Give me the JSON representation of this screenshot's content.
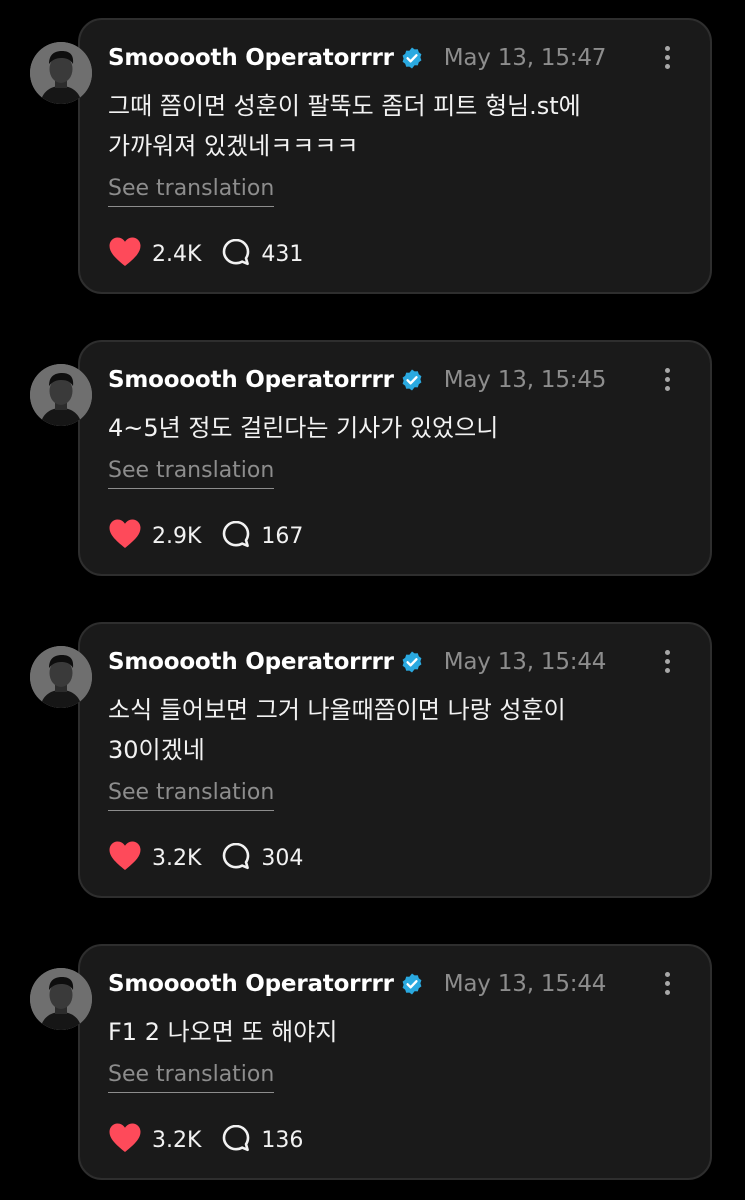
{
  "colors": {
    "background": "#000000",
    "card": "#1a1a1a",
    "card_border": "#2e2e2e",
    "verified_badge": "#2aa9e0",
    "like_heart": "#fe4a5a",
    "muted_text": "#8d8d8d"
  },
  "icons": {
    "verified": "verified-badge-icon",
    "like": "heart-icon",
    "reply": "speech-bubble-icon",
    "more": "more-vertical-icon"
  },
  "posts": [
    {
      "username": "Smooooth Operatorrrr",
      "timestamp": "May 13, 15:47",
      "text": "그때 쯤이면 성훈이 팔뚝도 좀더 피트 형님.st에\n가까워져 있겠네ㅋㅋㅋㅋ",
      "translate_label": "See translation",
      "likes": "2.4K",
      "replies": "431"
    },
    {
      "username": "Smooooth Operatorrrr",
      "timestamp": "May 13, 15:45",
      "text": "4~5년 정도 걸린다는 기사가 있었으니",
      "translate_label": "See translation",
      "likes": "2.9K",
      "replies": "167"
    },
    {
      "username": "Smooooth Operatorrrr",
      "timestamp": "May 13, 15:44",
      "text": "소식 들어보면 그거 나올때쯤이면 나랑 성훈이\n30이겠네",
      "translate_label": "See translation",
      "likes": "3.2K",
      "replies": "304"
    },
    {
      "username": "Smooooth Operatorrrr",
      "timestamp": "May 13, 15:44",
      "text": "F1 2 나오면 또 해야지",
      "translate_label": "See translation",
      "likes": "3.2K",
      "replies": "136"
    }
  ]
}
